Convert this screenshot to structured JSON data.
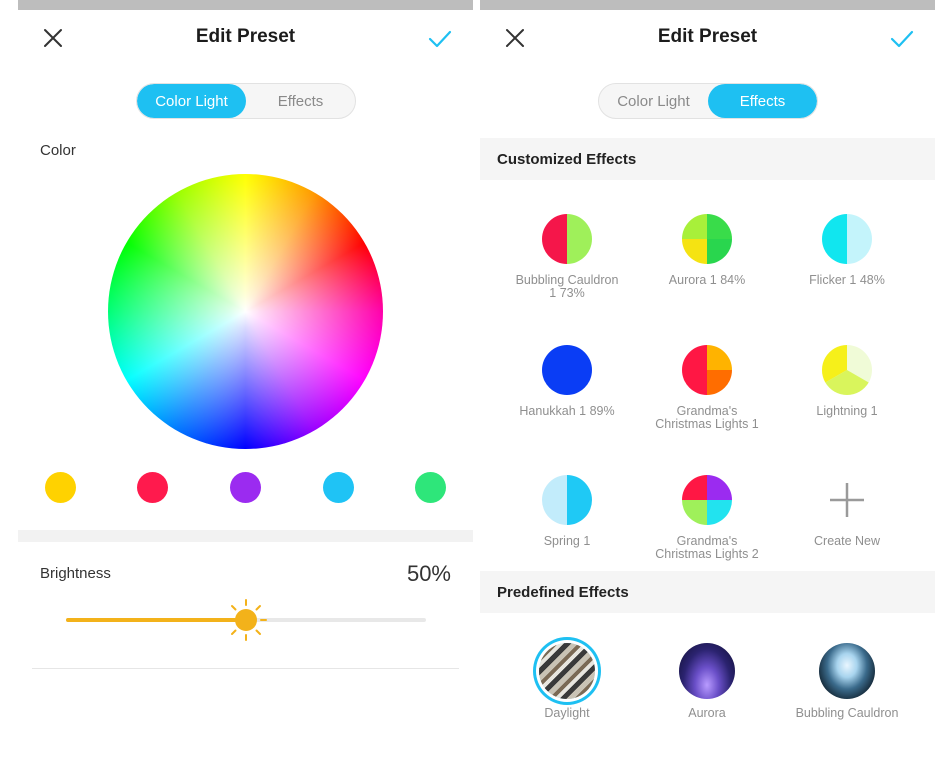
{
  "colors": {
    "accent": "#1ec0f2",
    "slider": "#f3b21a"
  },
  "left": {
    "title": "Edit Preset",
    "tabs": [
      "Color Light",
      "Effects"
    ],
    "active_tab": 0,
    "color_label": "Color",
    "swatches": [
      {
        "name": "yellow",
        "color": "#ffd200"
      },
      {
        "name": "red",
        "color": "#ff1a4d"
      },
      {
        "name": "purple",
        "color": "#9b2bf0"
      },
      {
        "name": "sky-blue",
        "color": "#1fc3f5"
      },
      {
        "name": "green",
        "color": "#2ee67a"
      }
    ],
    "brightness_label": "Brightness",
    "brightness_value": "50%",
    "brightness_fraction": 0.5
  },
  "right": {
    "title": "Edit Preset",
    "tabs": [
      "Color Light",
      "Effects"
    ],
    "active_tab": 1,
    "customized_header": "Customized Effects",
    "customized": [
      {
        "label": "Bubbling Cauldron\n1 73%",
        "icon": "split-red-green"
      },
      {
        "label": "Aurora 1 84%",
        "icon": "quad-green-yellow"
      },
      {
        "label": "Flicker 1 48%",
        "icon": "split-cyan-lightblue"
      },
      {
        "label": "Hanukkah 1 89%",
        "icon": "solid-blue"
      },
      {
        "label": "Grandma's\nChristmas Lights 1",
        "icon": "quad-red-orange"
      },
      {
        "label": "Lightning 1",
        "icon": "yellow-lightgreen"
      },
      {
        "label": "Spring 1",
        "icon": "split-lightblue-cyan"
      },
      {
        "label": "Grandma's\nChristmas Lights 2",
        "icon": "quad-red-purple-green-cyan"
      },
      {
        "label": "Create New",
        "icon": "plus-icon"
      }
    ],
    "predefined_header": "Predefined Effects",
    "predefined": [
      {
        "label": "Daylight",
        "icon": "daylight-photo",
        "selected": true
      },
      {
        "label": "Aurora",
        "icon": "aurora-photo",
        "selected": false
      },
      {
        "label": "Bubbling Cauldron",
        "icon": "cauldron-photo",
        "selected": false
      }
    ]
  }
}
